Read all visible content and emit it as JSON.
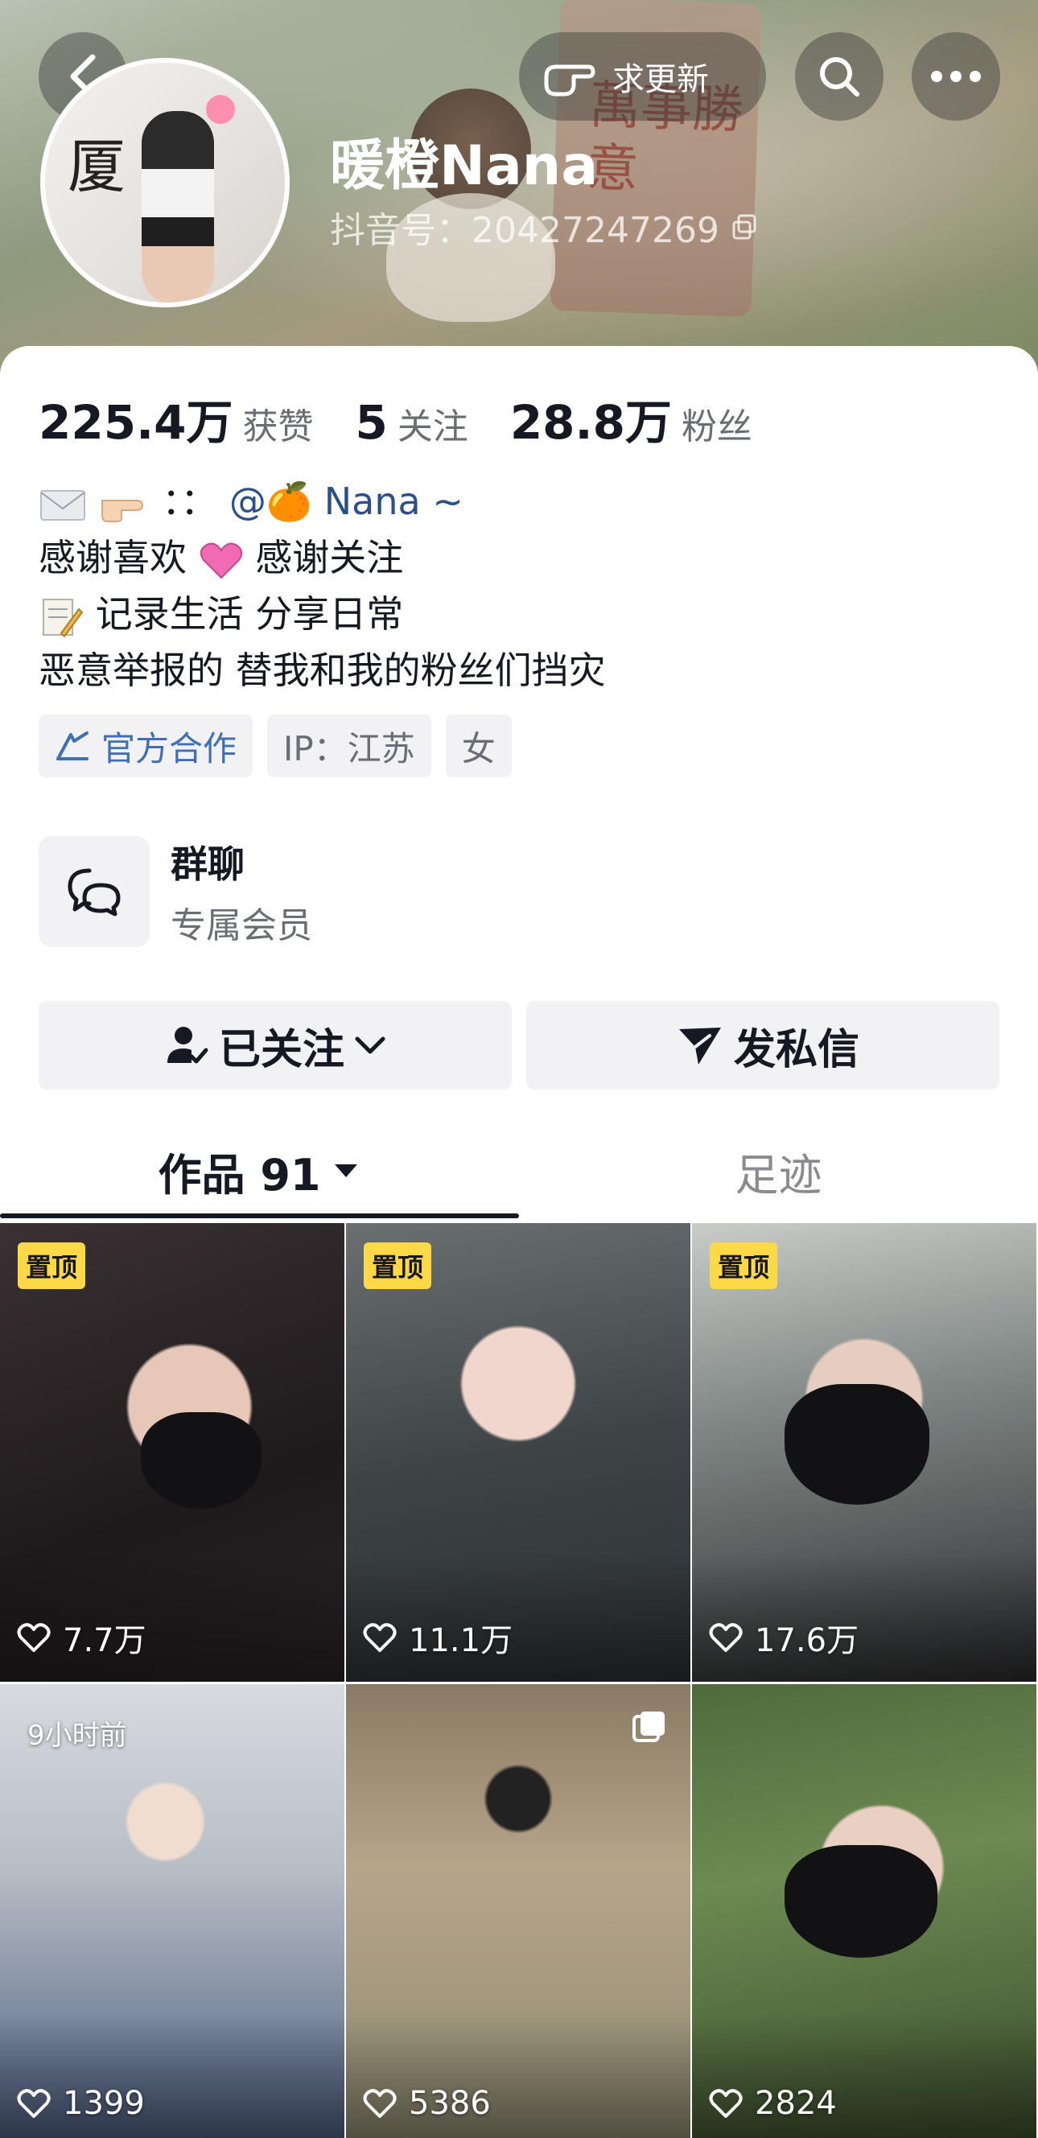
{
  "header": {
    "update_label": "求更新",
    "nickname": "暖橙Nana",
    "douyin_id": "抖音号：20427247269",
    "banner_text": "萬事勝意",
    "avatar_text": "厦"
  },
  "stats": [
    {
      "value": "225.4万",
      "label": "获赞"
    },
    {
      "value": "5",
      "label": "关注"
    },
    {
      "value": "28.8万",
      "label": "粉丝"
    }
  ],
  "bio": {
    "line1_prefix": "：：",
    "line1_mention": "@🍊 Nana ~",
    "line2_a": "感谢喜欢",
    "line2_b": "感谢关注",
    "line3": "记录生活 分享日常",
    "line4": "恶意举报的 替我和我的粉丝们挡灾"
  },
  "tags": {
    "official": "官方合作",
    "ip": "IP：江苏",
    "gender": "女"
  },
  "group_chat": {
    "title": "群聊",
    "subtitle": "专属会员"
  },
  "actions": {
    "followed": "已关注",
    "message": "发私信"
  },
  "tabs": {
    "works": "作品 91",
    "footprint": "足迹"
  },
  "videos": [
    {
      "pinned": "置顶",
      "likes": "7.7万"
    },
    {
      "pinned": "置顶",
      "likes": "11.1万"
    },
    {
      "pinned": "置顶",
      "likes": "17.6万"
    },
    {
      "time": "9小时前",
      "likes": "1399"
    },
    {
      "likes": "5386"
    },
    {
      "likes": "2824"
    }
  ],
  "colors": {
    "accent_blue": "#3f6fb5",
    "pin_yellow": "#fdd947",
    "text_primary": "#161823",
    "text_secondary": "#6b6d76"
  }
}
